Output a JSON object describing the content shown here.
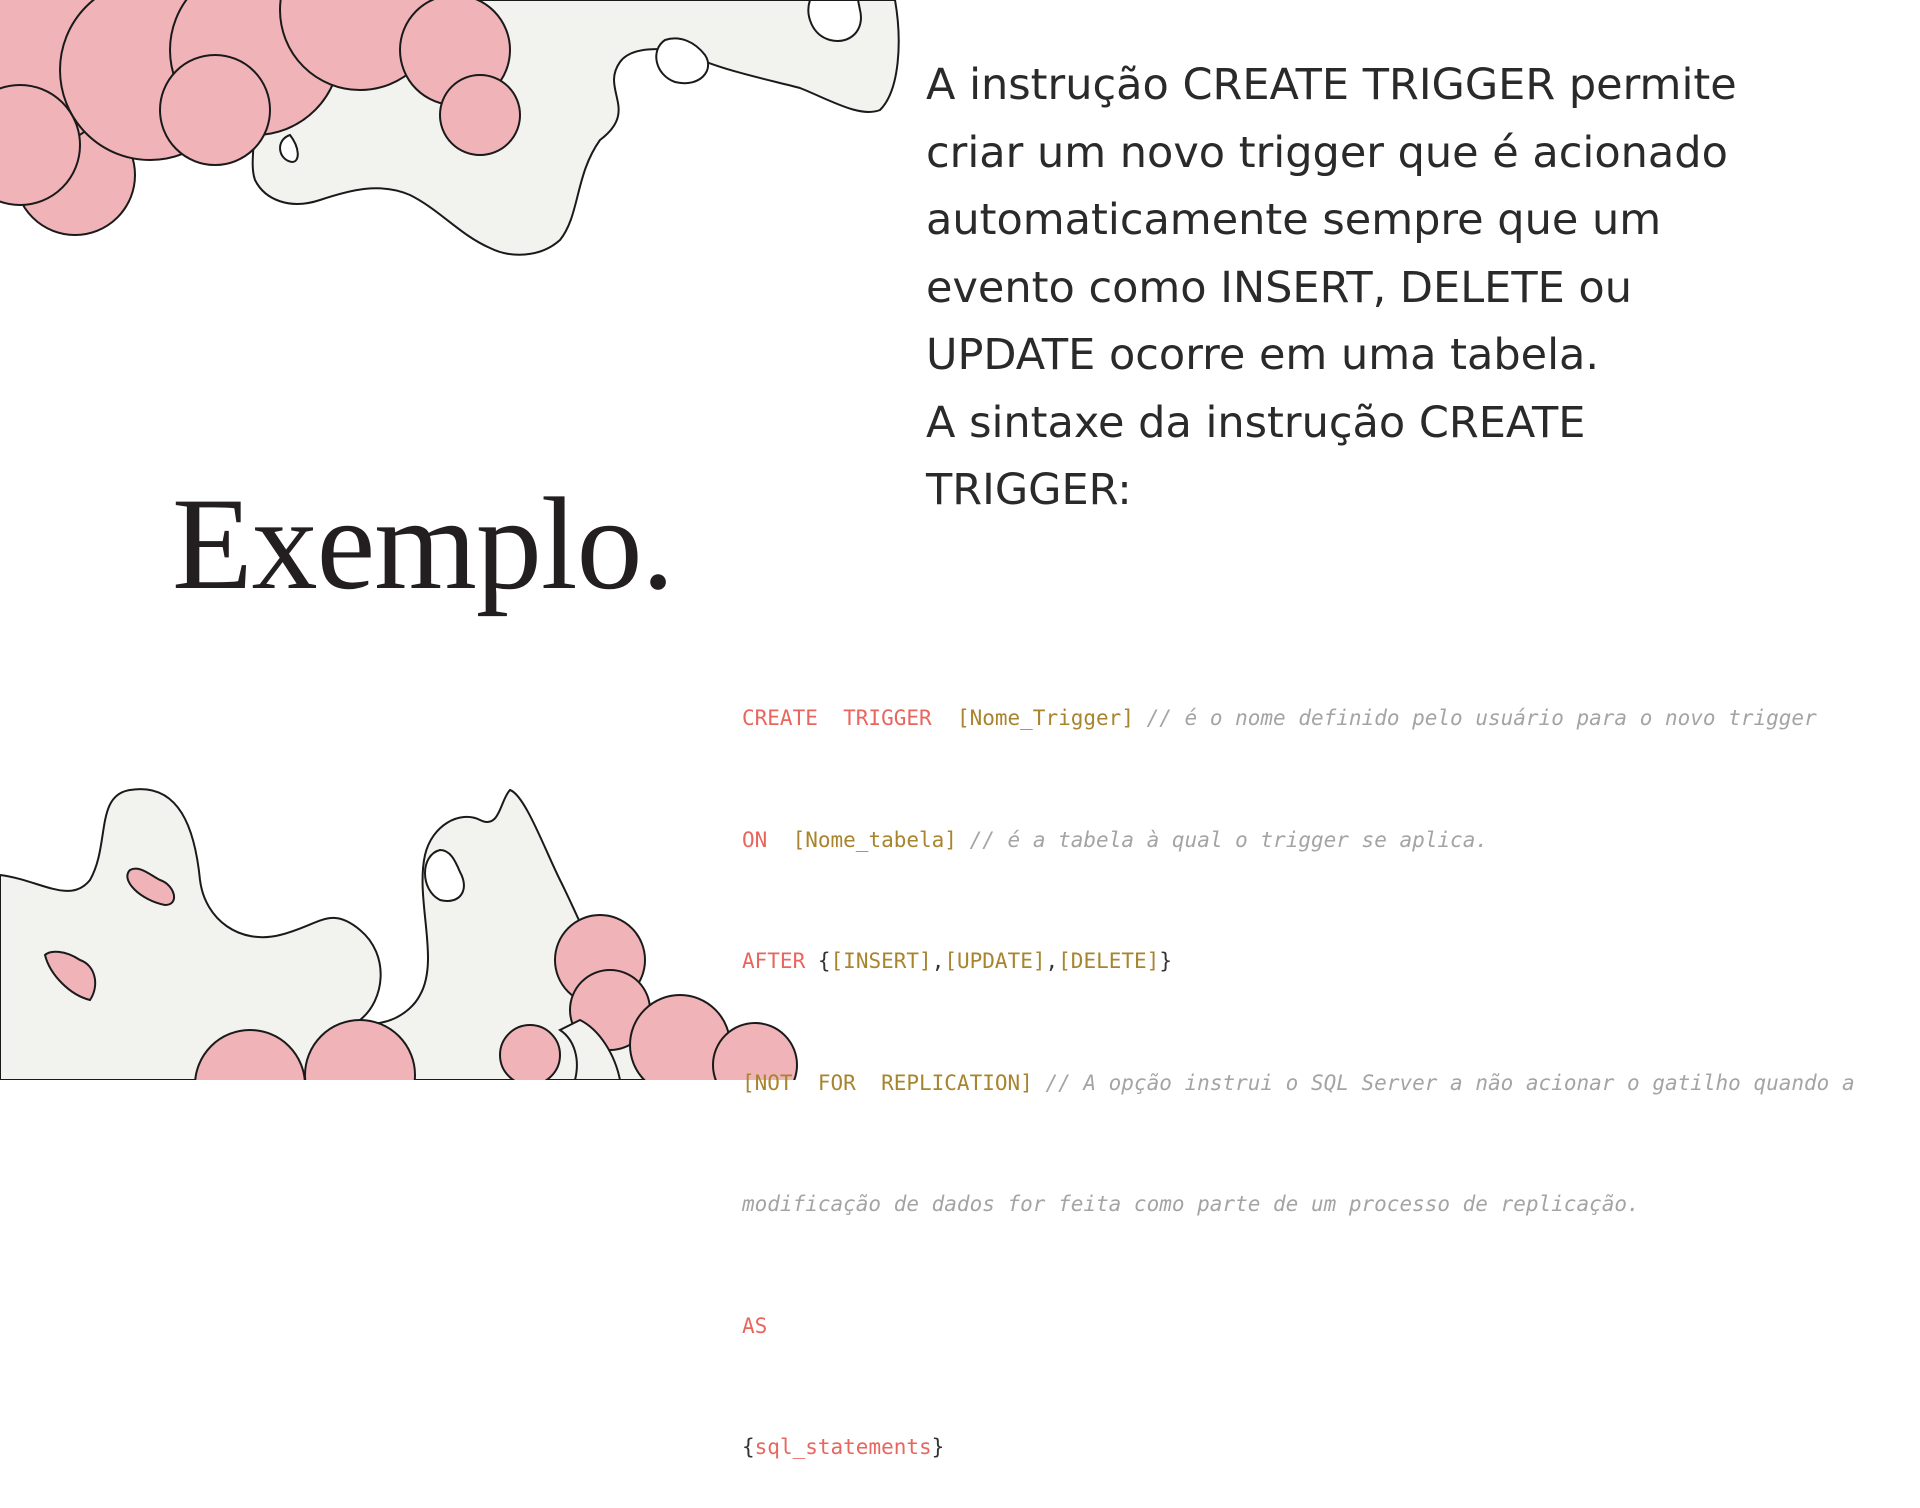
{
  "slide": {
    "title": "Exemplo.",
    "description_lines": [
      "A instrução CREATE TRIGGER permite criar um novo trigger que é acionado automaticamente sempre que um evento como INSERT, DELETE ou UPDATE ocorre em uma tabela.",
      "A sintaxe da instrução CREATE TRIGGER:"
    ],
    "code": {
      "line1": {
        "kw1": "CREATE  TRIGGER",
        "br1": "[Nome_Trigger]",
        "cm1": "// é o nome definido pelo usuário para o novo trigger"
      },
      "line2": {
        "kw1": "ON",
        "br1": "[Nome_tabela]",
        "cm1": "// é a tabela à qual o trigger se aplica."
      },
      "line3": {
        "kw1": "AFTER",
        "p1": "{",
        "br1": "[INSERT]",
        "p2": ",",
        "br2": "[UPDATE]",
        "p3": ",",
        "br3": "[DELETE]",
        "p4": "}"
      },
      "line4": {
        "br1": "[NOT  FOR  REPLICATION]",
        "cm1": "// A opção instrui o SQL Server a não acionar o gatilho quando a"
      },
      "line5": {
        "cm1": "modificação de dados for feita como parte de um processo de replicação."
      },
      "line6": {
        "kw1": "AS"
      },
      "line7": {
        "p1": "{",
        "kw1": "sql_statements",
        "p2": "}"
      }
    },
    "colors": {
      "background": "#ffffff",
      "blob_pink": "#f0b4b8",
      "blob_cream": "#f2f3ee",
      "keyword": "#e8665e",
      "bracket": "#a8842f",
      "comment": "#a4a4a4"
    }
  }
}
